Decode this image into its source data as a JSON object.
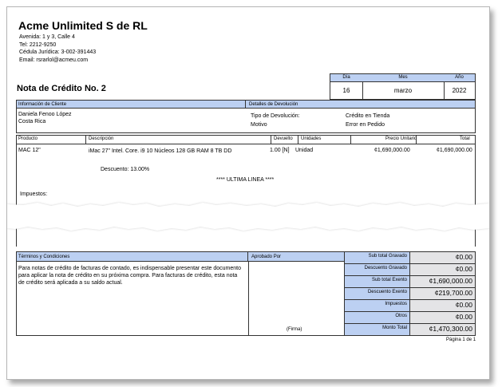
{
  "company": {
    "name": "Acme Unlimited S de RL",
    "address": "Avenida: 1 y 3, Calle 4",
    "phone": "Tel: 2212-9250",
    "legal_id": "Cédula Jurídica: 3-002-391443",
    "email": "Email: rsrarlol@acmeu.com"
  },
  "document": {
    "title": "Nota de Crédito No. 2"
  },
  "date": {
    "day_label": "Día",
    "month_label": "Mes",
    "year_label": "Año",
    "day": "16",
    "month": "marzo",
    "year": "2022"
  },
  "client": {
    "header": "Información de Cliente",
    "name": "Daniela Fenoo López",
    "country": "Costa Rica"
  },
  "return_details": {
    "header": "Detalles de Devolución",
    "type_label": "Tipo de Devolución:",
    "type_value": "Crédito en Tienda",
    "reason_label": "Motivo",
    "reason_value": "Error en Pedido"
  },
  "table": {
    "headers": {
      "product": "Producto",
      "description": "Descripción",
      "returned": "Devuelto",
      "units": "Unidades",
      "unit_price": "Precio Unitario",
      "total": "Total"
    },
    "rows": [
      {
        "product": "MAC 12\"",
        "description": "iMac 27\" Intel. Core. i9 10 Núcleos 128 GB RAM 8 TB DD",
        "returned": "1.00 [N]",
        "units": "Unidad",
        "unit_price": "¢1,690,000.00",
        "total": "¢1,690,000.00"
      }
    ],
    "discount_line": "Descuento: 13.00%",
    "end_line": "**** ULTIMA LINEA ****",
    "taxes_label": "Impuestos:"
  },
  "terms": {
    "header": "Términos y Condiciones",
    "text": "Para notas de crédito de facturas de contado, es indispensable presentar este documento para aplicar la nota de crédito en su próxima compra. Para facturas de crédito, esta nota de crédito será aplicada a su saldo actual."
  },
  "approved": {
    "header": "Aprobado Por",
    "signature_label": "(Firma)"
  },
  "totals": [
    {
      "label": "Sub total Gravado",
      "value": "¢0.00"
    },
    {
      "label": "Descuento Gravado",
      "value": "¢0.00"
    },
    {
      "label": "Sub total Exento",
      "value": "¢1,690,000.00"
    },
    {
      "label": "Descuento Exento",
      "value": "¢219,700.00"
    },
    {
      "label": "Impuestos",
      "value": "¢0.00"
    },
    {
      "label": "Otros",
      "value": "¢0.00"
    },
    {
      "label": "Monto Total",
      "value": "¢1,470,300.00"
    }
  ],
  "footer": {
    "page": "Página 1 de 1"
  },
  "colors": {
    "header_blue": "#bcd0f2",
    "total_gray": "#e4e4e6"
  }
}
